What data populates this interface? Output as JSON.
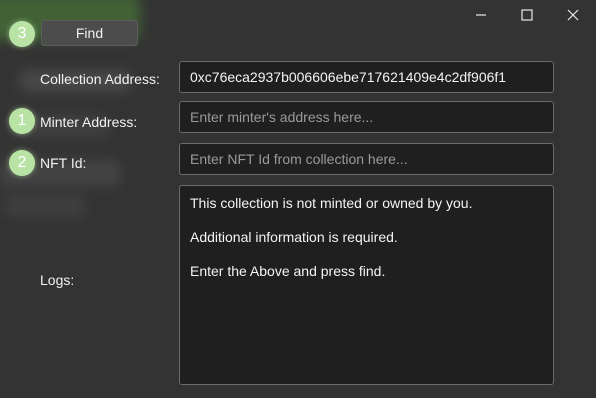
{
  "window": {
    "controls": [
      "minimize-icon",
      "maximize-icon",
      "close-icon"
    ]
  },
  "badges": {
    "find": "3",
    "minter": "1",
    "nft_id": "2"
  },
  "toolbar": {
    "find_label": "Find"
  },
  "form": {
    "collection_label": "Collection Address:",
    "collection_value": "0xc76eca2937b006606ebe717621409e4c2df906f1",
    "minter_label": "Minter Address:",
    "minter_placeholder": "Enter minter's address here...",
    "nft_label": "NFT Id:",
    "nft_placeholder": "Enter NFT Id from collection here...",
    "logs_label": "Logs:"
  },
  "logs": {
    "lines": [
      "This collection is not minted or owned by you.",
      "Additional information is required.",
      "Enter the Above and press find."
    ]
  },
  "colors": {
    "background": "#333333",
    "field_background": "#1f1f1f",
    "badge": "#b9e3a5"
  }
}
